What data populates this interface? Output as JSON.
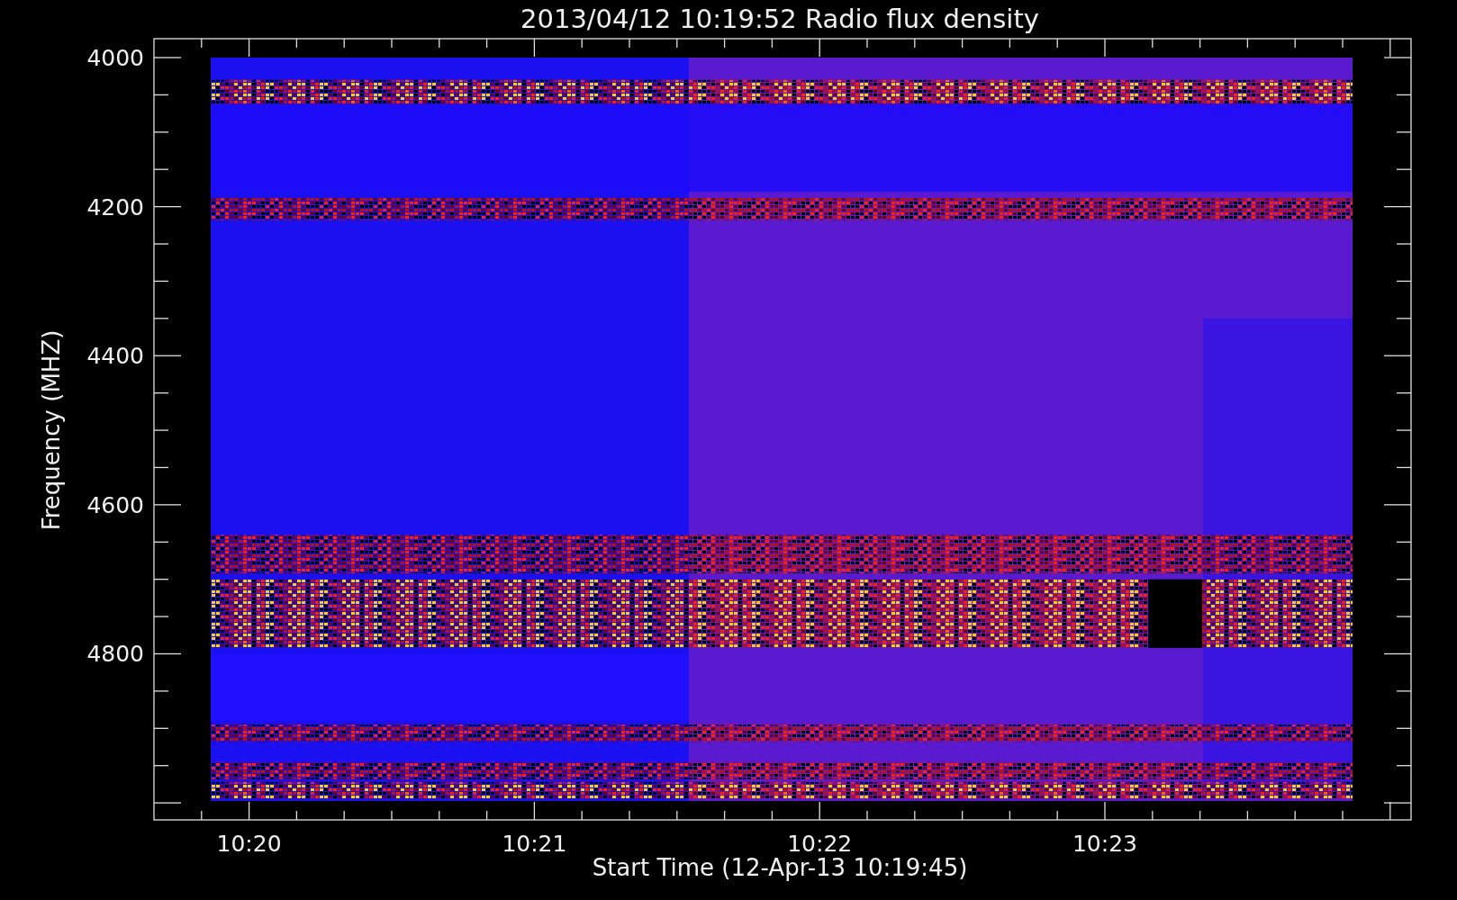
{
  "plot": {
    "title": "2013/04/12 10:19:52 Radio flux density",
    "xlabel": "Start Time (12-Apr-13 10:19:45)",
    "ylabel": "Frequency (MHZ)",
    "yticks": [
      "4000",
      "4200",
      "4400",
      "4600",
      "4800"
    ],
    "xticks": [
      "10:20",
      "10:21",
      "10:22",
      "10:23"
    ]
  }
}
